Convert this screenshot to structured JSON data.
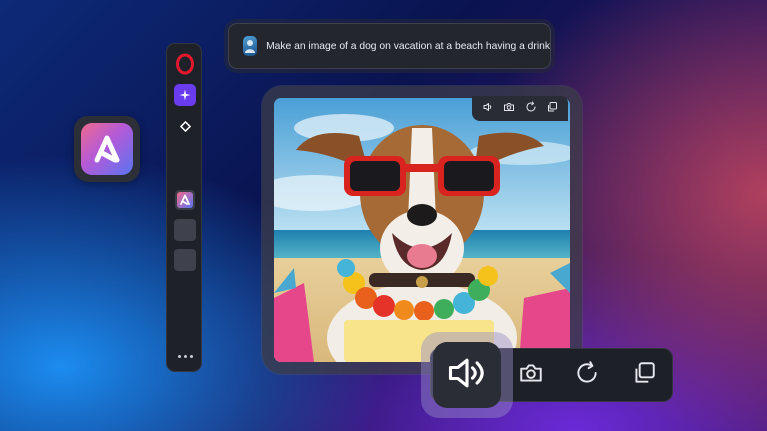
{
  "prompt": {
    "text": "Make an image of a dog on vacation at a beach having a drink"
  },
  "sidebar": {
    "items": [
      "opera-logo-icon",
      "aria-icon",
      "diamond-icon",
      "aria-app-icon",
      "empty-slot",
      "empty-slot",
      "more-icon"
    ]
  },
  "image_toolbar": {
    "icons": [
      "speaker-icon",
      "camera-icon",
      "refresh-icon",
      "copy-icon"
    ]
  },
  "large_toolbar": {
    "icons": [
      "speaker-icon",
      "camera-icon",
      "refresh-icon",
      "copy-icon"
    ]
  },
  "colors": {
    "opera_red": "#e3182d",
    "aria_purple": "#6a3cf0",
    "panel": "#1f2128"
  }
}
